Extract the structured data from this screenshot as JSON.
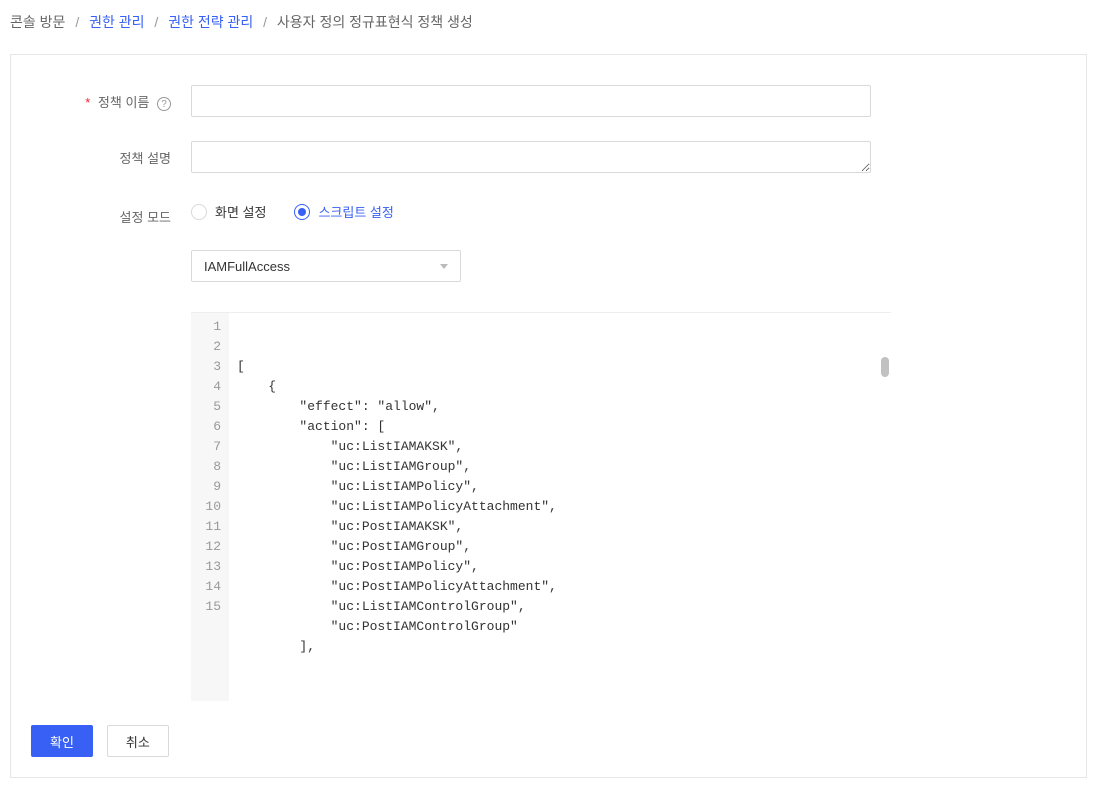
{
  "breadcrumb": {
    "items": [
      "콘솔 방문",
      "권한 관리",
      "권한 전략 관리"
    ],
    "current": "사용자 정의 정규표현식 정책 생성"
  },
  "form": {
    "policy_name_label": "정책 이름",
    "policy_name_value": "",
    "policy_desc_label": "정책 설명",
    "policy_desc_value": "",
    "mode_label": "설정 모드",
    "mode_options": {
      "visual": "화면 설정",
      "script": "스크립트 설정"
    },
    "template_select": "IAMFullAccess"
  },
  "code": {
    "lines": [
      "[",
      "    {",
      "        \"effect\": \"allow\",",
      "        \"action\": [",
      "            \"uc:ListIAMAKSK\",",
      "            \"uc:ListIAMGroup\",",
      "            \"uc:ListIAMPolicy\",",
      "            \"uc:ListIAMPolicyAttachment\",",
      "            \"uc:PostIAMAKSK\",",
      "            \"uc:PostIAMGroup\",",
      "            \"uc:PostIAMPolicy\",",
      "            \"uc:PostIAMPolicyAttachment\",",
      "            \"uc:ListIAMControlGroup\",",
      "            \"uc:PostIAMControlGroup\"",
      "        ],"
    ]
  },
  "buttons": {
    "confirm": "확인",
    "cancel": "취소"
  }
}
